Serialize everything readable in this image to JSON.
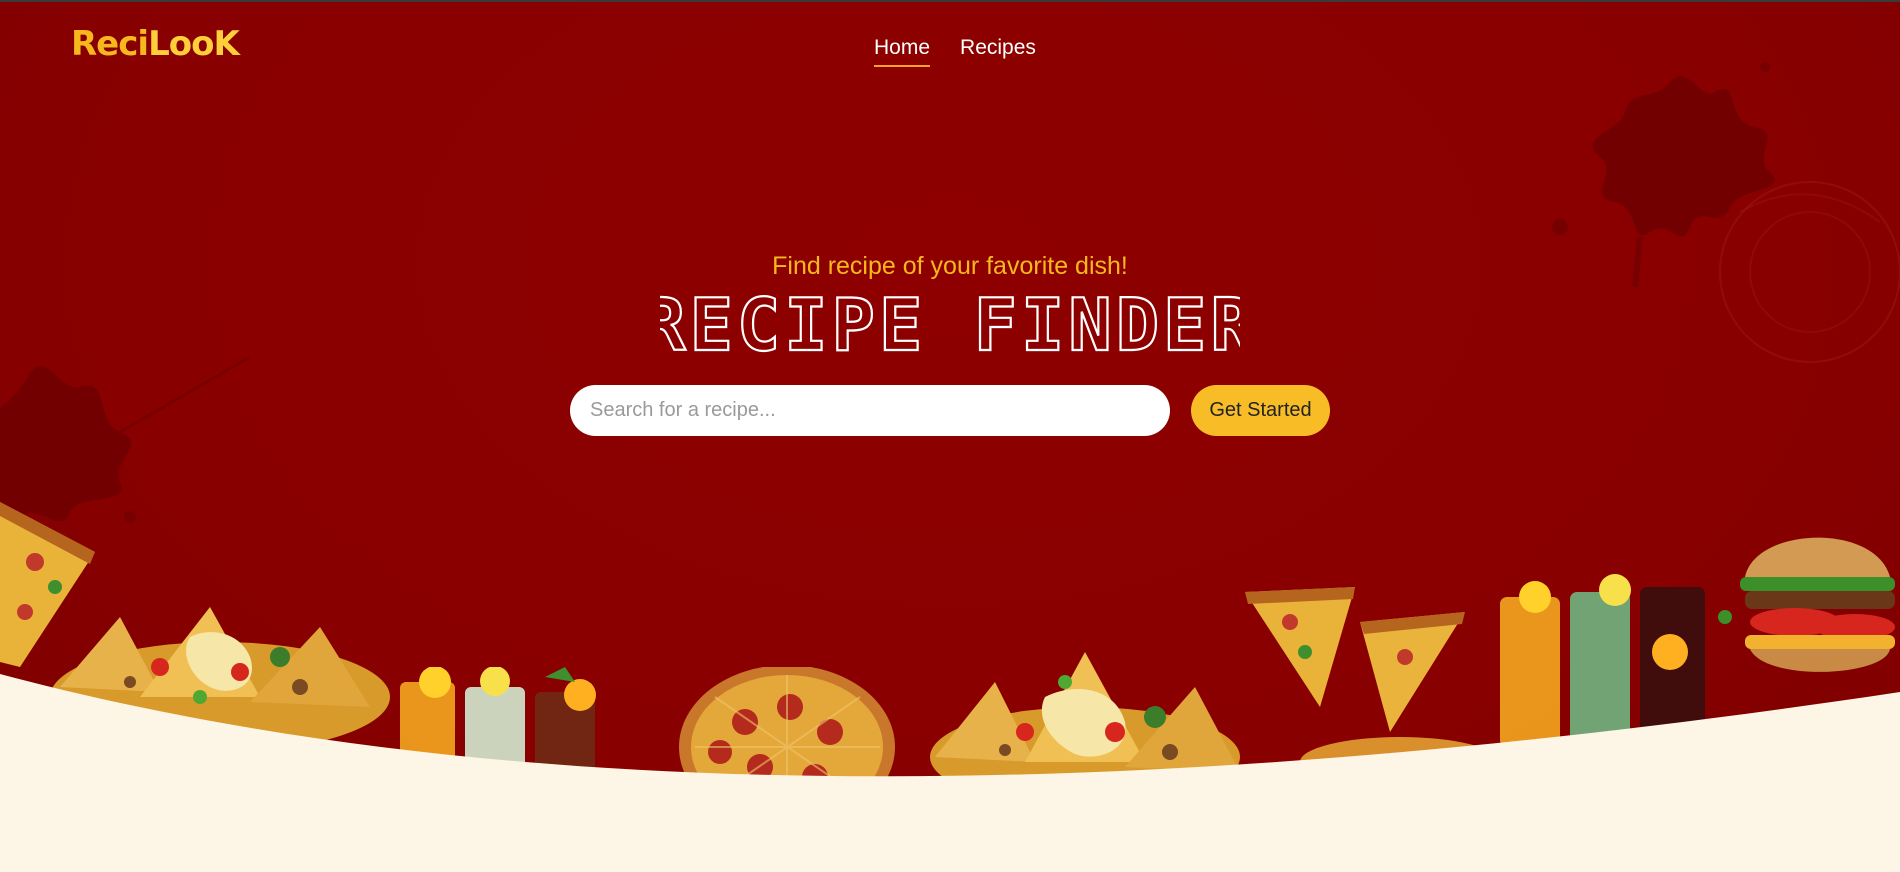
{
  "brand": {
    "logo_a": "Reci",
    "logo_b": "LooK"
  },
  "nav": {
    "items": [
      {
        "label": "Home",
        "active": true
      },
      {
        "label": "Recipes",
        "active": false
      }
    ]
  },
  "hero": {
    "subtitle": "Find recipe of your favorite dish!",
    "title": "RECIPE FINDER",
    "search_placeholder": "Search for a recipe...",
    "cta_label": "Get Started"
  },
  "colors": {
    "hero_bg": "#890000",
    "accent": "#f8bd26",
    "cream": "#fdf5e6"
  },
  "decor": {
    "food_items": [
      "pizza-slice",
      "nachos",
      "cocktail-glasses",
      "whole-pizza",
      "nachos",
      "pizza-slices",
      "cocktail-glasses",
      "burger"
    ]
  }
}
